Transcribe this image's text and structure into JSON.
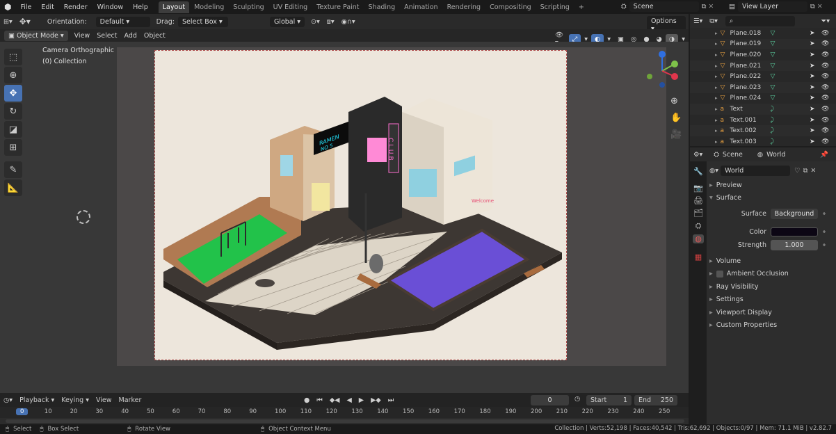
{
  "topbar": {
    "menus": [
      "File",
      "Edit",
      "Render",
      "Window",
      "Help"
    ],
    "workspaces": [
      "Layout",
      "Modeling",
      "Sculpting",
      "UV Editing",
      "Texture Paint",
      "Shading",
      "Animation",
      "Rendering",
      "Compositing",
      "Scripting"
    ],
    "active_workspace": "Layout",
    "add_tab": "+",
    "scene_name": "Scene",
    "view_layer": "View Layer"
  },
  "viewport_header": {
    "orientation_label": "Orientation:",
    "orientation_value": "Default",
    "drag_label": "Drag:",
    "drag_value": "Select Box",
    "transform_orientation": "Global",
    "options": "Options"
  },
  "viewport_header2": {
    "mode": "Object Mode",
    "menus": [
      "View",
      "Select",
      "Add",
      "Object"
    ]
  },
  "viewport": {
    "camera_label": "Camera Orthographic",
    "collection_label": "(0) Collection"
  },
  "render_scene": {
    "club_sign": "CLUB",
    "welcome_sign": "Welcome",
    "neon_sign_line1": "RAMEN",
    "neon_sign_line2": "NO 5"
  },
  "timeline": {
    "menus": [
      "Playback",
      "Keying",
      "View",
      "Marker"
    ],
    "current_frame": "0",
    "start_label": "Start",
    "start_value": "1",
    "end_label": "End",
    "end_value": "250",
    "ruler": [
      "0",
      "10",
      "20",
      "30",
      "40",
      "50",
      "60",
      "70",
      "80",
      "90",
      "100",
      "110",
      "120",
      "130",
      "140",
      "150",
      "160",
      "170",
      "180",
      "190",
      "200",
      "210",
      "220",
      "230",
      "240",
      "250"
    ]
  },
  "statusbar": {
    "select": "Select",
    "box_select": "Box Select",
    "rotate_view": "Rotate View",
    "context_menu": "Object Context Menu",
    "stats": "Collection | Verts:52,198 | Faces:40,542 | Tris:62,692 | Objects:0/97 | Mem: 71.1 MiB | v2.82.7"
  },
  "outliner": {
    "rows": [
      {
        "name": "Plane.018",
        "type": "mesh"
      },
      {
        "name": "Plane.019",
        "type": "mesh"
      },
      {
        "name": "Plane.020",
        "type": "mesh"
      },
      {
        "name": "Plane.021",
        "type": "mesh"
      },
      {
        "name": "Plane.022",
        "type": "mesh"
      },
      {
        "name": "Plane.023",
        "type": "mesh"
      },
      {
        "name": "Plane.024",
        "type": "mesh"
      },
      {
        "name": "Text",
        "type": "text"
      },
      {
        "name": "Text.001",
        "type": "text"
      },
      {
        "name": "Text.002",
        "type": "text"
      },
      {
        "name": "Text.003",
        "type": "text"
      }
    ]
  },
  "properties": {
    "scene_tab": "Scene",
    "world_tab": "World",
    "world_name": "World",
    "sections": {
      "preview": "Preview",
      "surface": "Surface",
      "volume": "Volume",
      "ambient_occlusion": "Ambient Occlusion",
      "ray_visibility": "Ray Visibility",
      "settings": "Settings",
      "viewport_display": "Viewport Display",
      "custom_properties": "Custom Properties"
    },
    "surface_label": "Surface",
    "surface_value": "Background",
    "color_label": "Color",
    "color_value": "#0c0614",
    "strength_label": "Strength",
    "strength_value": "1.000"
  },
  "colors": {
    "accent": "#4772b3",
    "pool": "#6a4fd6",
    "grass": "#22c24a",
    "neon_pink": "#ff6fd0",
    "neon_cyan": "#23e6ff"
  }
}
